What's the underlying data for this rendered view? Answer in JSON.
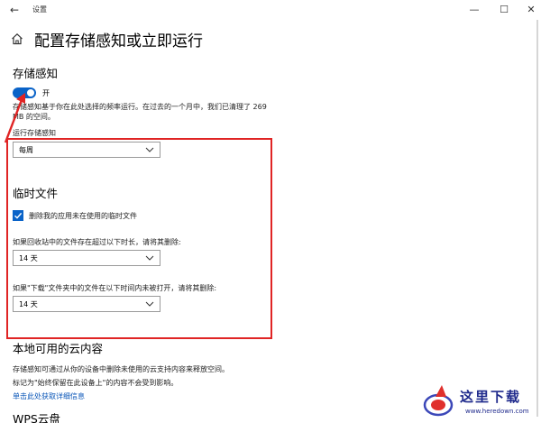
{
  "window": {
    "title": "设置",
    "back_icon": "back-arrow-icon",
    "minimize_glyph": "—",
    "maximize_glyph": "☐",
    "close_glyph": "✕"
  },
  "page": {
    "title": "配置存储感知或立即运行",
    "home_icon": "home-icon"
  },
  "storage_sense": {
    "heading": "存储感知",
    "toggle_label": "开",
    "toggle_on": true,
    "description": "存储感知基于你在此处选择的频率运行。在过去的一个月中，我们已清理了 269 MB 的空间。",
    "run_label": "运行存储感知",
    "run_value": "每周"
  },
  "temp_files": {
    "heading": "临时文件",
    "checkbox_label": "删除我的应用未在使用的临时文件",
    "checkbox_checked": true,
    "recycle_label": "如果回收站中的文件存在超过以下时长，请将其删除:",
    "recycle_value": "14 天",
    "download_label": "如果\"下载\"文件夹中的文件在以下时间内未被打开，请将其删除:",
    "download_value": "14 天"
  },
  "cloud": {
    "heading": "本地可用的云内容",
    "desc_1": "存储感知可通过从你的设备中删除未使用的云支持内容来释放空间。",
    "desc_2": "标记为\"始终保留在此设备上\"的内容不会受到影响。",
    "link": "单击此处获取详细信息"
  },
  "wps": {
    "heading": "WPS云盘"
  },
  "watermark": {
    "text": "这里下载",
    "url": "www.heredown.com"
  },
  "colors": {
    "accent": "#0a63c8",
    "highlight": "#e02424",
    "link": "#0a56b8"
  }
}
